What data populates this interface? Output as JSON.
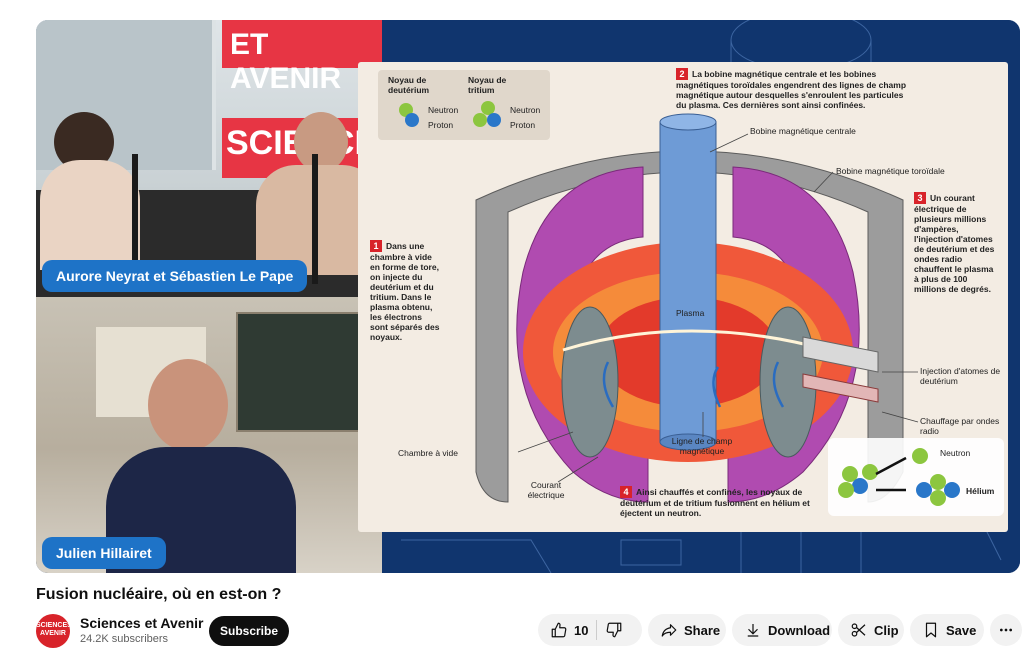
{
  "video": {
    "title": "Fusion nucléaire, où en est-on ?",
    "speaker_top": "Aurore Neyrat et Sébastien Le Pape",
    "speaker_bottom": "Julien Hillairet",
    "banner_top": "ET AVENIR",
    "banner_mid": "SCIENCES",
    "banner_et": "ET"
  },
  "diagram": {
    "legend_deut": "Noyau de deutérium",
    "legend_trit": "Noyau de tritium",
    "neutron": "Neutron",
    "proton": "Proton",
    "step1": "Dans une chambre à vide en forme de tore, on injecte du deutérium et du tritium. Dans le plasma obtenu, les électrons sont séparés des noyaux.",
    "step2": "La bobine magnétique centrale et les bobines magnétiques toroïdales engendrent des lignes de champ magnétique autour desquelles s'enroulent les particules du plasma. Ces dernières sont ainsi confinées.",
    "step3": "Un courant électrique de plusieurs millions d'ampères, l'injection d'atomes de deutérium et des ondes radio chauffent le plasma à plus de 100 millions de degrés.",
    "step4": "Ainsi chauffés et confinés, les noyaux de deutérium et de tritium fusionnent en hélium et éjectent un neutron.",
    "n1": "1",
    "n2": "2",
    "n3": "3",
    "n4": "4",
    "bobine_centrale": "Bobine magnétique centrale",
    "bobine_toroidale": "Bobine magnétique toroïdale",
    "plasma": "Plasma",
    "injection": "Injection d'atomes de deutérium",
    "chauffage": "Chauffage par ondes radio",
    "chambre": "Chambre à vide",
    "ligne": "Ligne de champ magnétique",
    "courant": "Courant électrique",
    "neutron_out": "Neutron",
    "helium": "Hélium"
  },
  "channel": {
    "avatar_text": "SCIENCES AVENIR",
    "name": "Sciences et Avenir",
    "subscribers": "24.2K subscribers",
    "subscribe_label": "Subscribe"
  },
  "actions": {
    "like_count": "10",
    "share_label": "Share",
    "download_label": "Download",
    "clip_label": "Clip",
    "save_label": "Save"
  },
  "colors": {
    "accent_red": "#d8232a",
    "nameplate_blue": "#1e73c7",
    "coil_purple": "#b04bb0"
  }
}
